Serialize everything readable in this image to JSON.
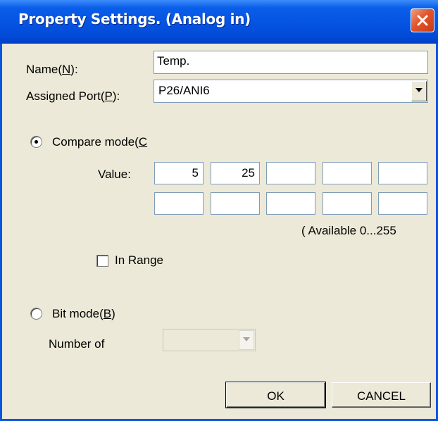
{
  "window": {
    "title": "Property Settings. (Analog in)"
  },
  "name_field": {
    "label_pre": "Name(",
    "label_key": "N",
    "label_post": "):",
    "value": "Temp."
  },
  "port_field": {
    "label_pre": "Assigned Port(",
    "label_key": "P",
    "label_post": "):",
    "value": "P26/ANI6"
  },
  "compare_mode": {
    "label_pre": "Compare mode(",
    "label_key": "C",
    "selected": true
  },
  "values": {
    "label": "Value:",
    "cells": [
      "5",
      "25",
      "",
      "",
      "",
      "",
      "",
      "",
      "",
      ""
    ],
    "available_note": "( Available  0...255"
  },
  "in_range": {
    "label": "In Range",
    "checked": false
  },
  "bit_mode": {
    "label_pre": "Bit mode(",
    "label_key": "B",
    "label_post": ")",
    "selected": false
  },
  "number_of": {
    "label": "Number of",
    "value": ""
  },
  "buttons": {
    "ok": "OK",
    "cancel": "CANCEL"
  }
}
